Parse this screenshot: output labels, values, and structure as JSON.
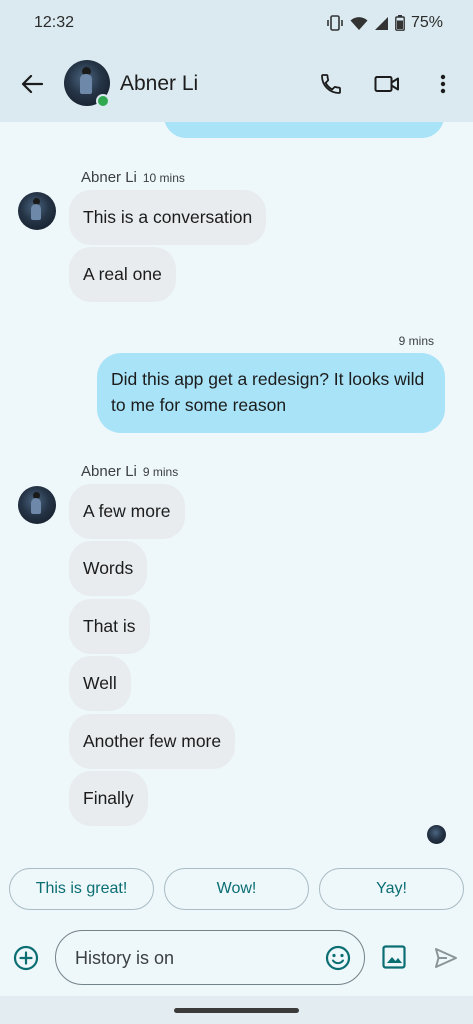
{
  "status_bar": {
    "time": "12:32",
    "battery": "75%",
    "icons": [
      "vibrate-icon",
      "wifi-icon",
      "signal-icon",
      "battery-icon"
    ]
  },
  "header": {
    "contact_name": "Abner Li",
    "online": true,
    "actions": [
      "phone-icon",
      "video-call-icon",
      "more-vert-icon"
    ]
  },
  "conversation": {
    "group1": {
      "sender": "Abner Li",
      "time": "10 mins",
      "messages": [
        "This is a conversation",
        "A real one"
      ]
    },
    "outgoing": {
      "time": "9 mins",
      "text": "Did this app get a redesign? It looks wild to me for some reason"
    },
    "group2": {
      "sender": "Abner Li",
      "time": "9 mins",
      "messages": [
        "A few more",
        "Words",
        "That is",
        "Well",
        "Another few more",
        "Finally"
      ]
    }
  },
  "smart_replies": [
    "This is great!",
    "Wow!",
    "Yay!"
  ],
  "compose": {
    "placeholder": "History is on"
  },
  "colors": {
    "background": "#eef7fa",
    "header": "#dbeaf0",
    "incoming_bubble": "#e8ecef",
    "outgoing_bubble": "#a8e3f7",
    "accent": "#0b6e73",
    "online": "#2fa84f"
  }
}
